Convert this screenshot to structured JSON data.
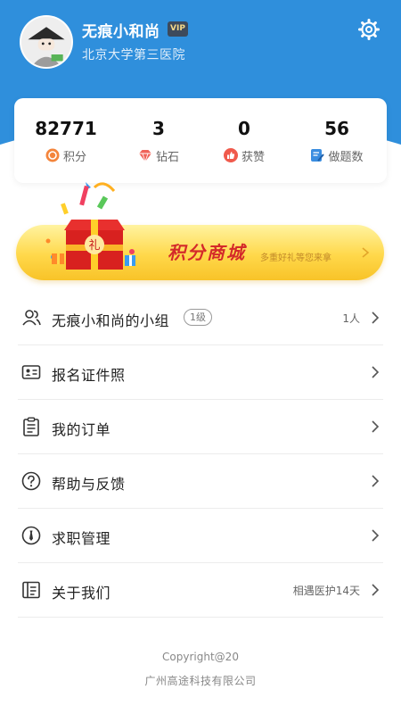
{
  "profile": {
    "name": "无痕小和尚",
    "vip_label": "VIP",
    "organization": "北京大学第三医院"
  },
  "header": {
    "settings_icon": "gear-icon"
  },
  "stats": [
    {
      "value": "82771",
      "label": "积分",
      "icon": "points-icon"
    },
    {
      "value": "3",
      "label": "钻石",
      "icon": "diamond-icon"
    },
    {
      "value": "0",
      "label": "获赞",
      "icon": "thumbs-up-icon"
    },
    {
      "value": "56",
      "label": "做题数",
      "icon": "exercise-icon"
    }
  ],
  "banner": {
    "title": "积分商城",
    "subtitle": "多重好礼等您来拿",
    "gift_text": "礼"
  },
  "menu": [
    {
      "label": "无痕小和尚的小组",
      "tag": "1级",
      "value": "1人",
      "icon": "group-icon"
    },
    {
      "label": "报名证件照",
      "tag": "",
      "value": "",
      "icon": "id-card-icon"
    },
    {
      "label": "我的订单",
      "tag": "",
      "value": "",
      "icon": "clipboard-icon"
    },
    {
      "label": "帮助与反馈",
      "tag": "",
      "value": "",
      "icon": "help-icon"
    },
    {
      "label": "求职管理",
      "tag": "",
      "value": "",
      "icon": "job-tie-icon"
    },
    {
      "label": "关于我们",
      "tag": "",
      "value": "相遇医护14天",
      "icon": "about-icon"
    }
  ],
  "footer": {
    "copyright": "Copyright@20",
    "company": "广州高途科技有限公司"
  },
  "colors": {
    "header_blue": "#2f8fdc",
    "banner_yellow": "#ffd84a",
    "banner_red": "#d42a2a",
    "points_orange": "#f4853c",
    "diamond_red": "#f0645a",
    "like_red": "#f05a4c",
    "exercise_blue": "#3a8de0"
  }
}
